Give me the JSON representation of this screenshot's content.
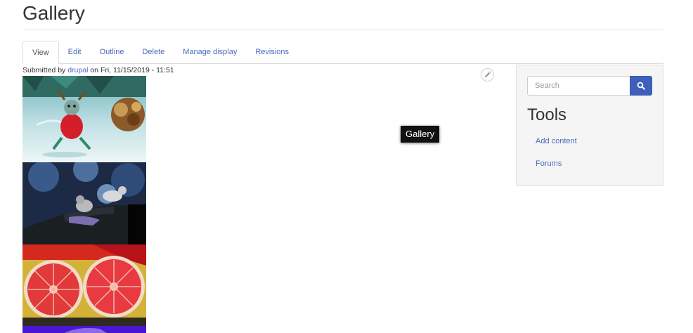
{
  "page": {
    "title": "Gallery"
  },
  "tabs": [
    {
      "label": "View",
      "active": true
    },
    {
      "label": "Edit"
    },
    {
      "label": "Outline"
    },
    {
      "label": "Delete"
    },
    {
      "label": "Manage display"
    },
    {
      "label": "Revisions"
    }
  ],
  "meta": {
    "submitted_by_prefix": "Submitted by",
    "author": "drupal",
    "date_text": "on Fri, 11/15/2019 - 11:51"
  },
  "images": [
    {
      "subject": "christmas-ornament-snowman-photo"
    },
    {
      "subject": "cats-on-tree-photo"
    },
    {
      "subject": "grapefruit-halves-photo"
    },
    {
      "subject": "purple-photo"
    }
  ],
  "tooltip": {
    "text": "Gallery"
  },
  "sidebar": {
    "search_placeholder": "Search",
    "search_icon": "search-icon",
    "tools_title": "Tools",
    "links": [
      "Add content",
      "Forums"
    ]
  },
  "colors": {
    "link": "#4a6bbf",
    "search_button": "#3f5fbd",
    "tooltip_bg": "#111111",
    "sidebar_bg": "#f5f5f5"
  }
}
